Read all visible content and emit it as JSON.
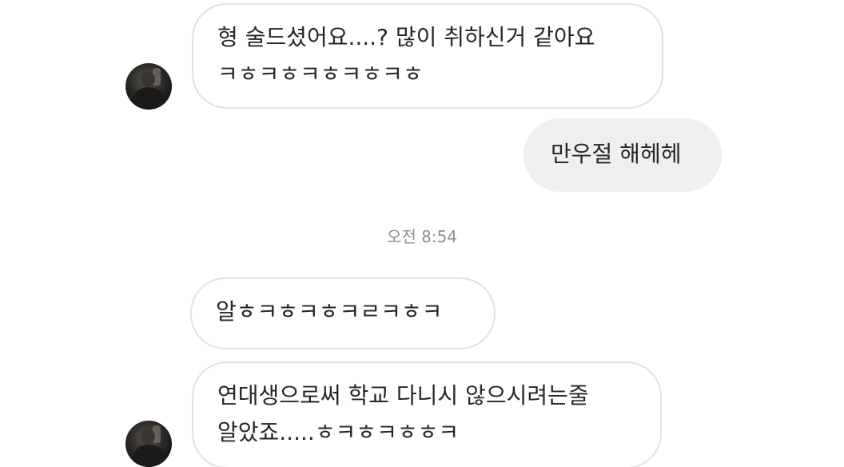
{
  "messages": [
    {
      "sender": "them",
      "line1": "형 술드셨어요....? 많이 취하신거 같아요",
      "line2": "ㅋㅎㅋㅎㅋㅎㅋㅎㅋㅎ"
    },
    {
      "sender": "me",
      "text": "만우절 해헤헤"
    },
    {
      "sender": "them",
      "text": "알ㅎㅋㅎㅋㅎㅋㄹㅋㅎㅋ"
    },
    {
      "sender": "them",
      "line1": "연대생으로써 학교 다니시 않으시려는줄",
      "line2": "알았죠.....ㅎㅋㅎㅋㅎㅎㅋ"
    }
  ],
  "timestamp": "오전 8:54",
  "icons": {
    "avatar": "contact-avatar"
  },
  "colors": {
    "incoming_bubble_bg": "#ffffff",
    "incoming_bubble_border": "#e2e2e2",
    "outgoing_bubble_bg": "#efefef",
    "text": "#262626",
    "timestamp": "#8e8e8e"
  }
}
